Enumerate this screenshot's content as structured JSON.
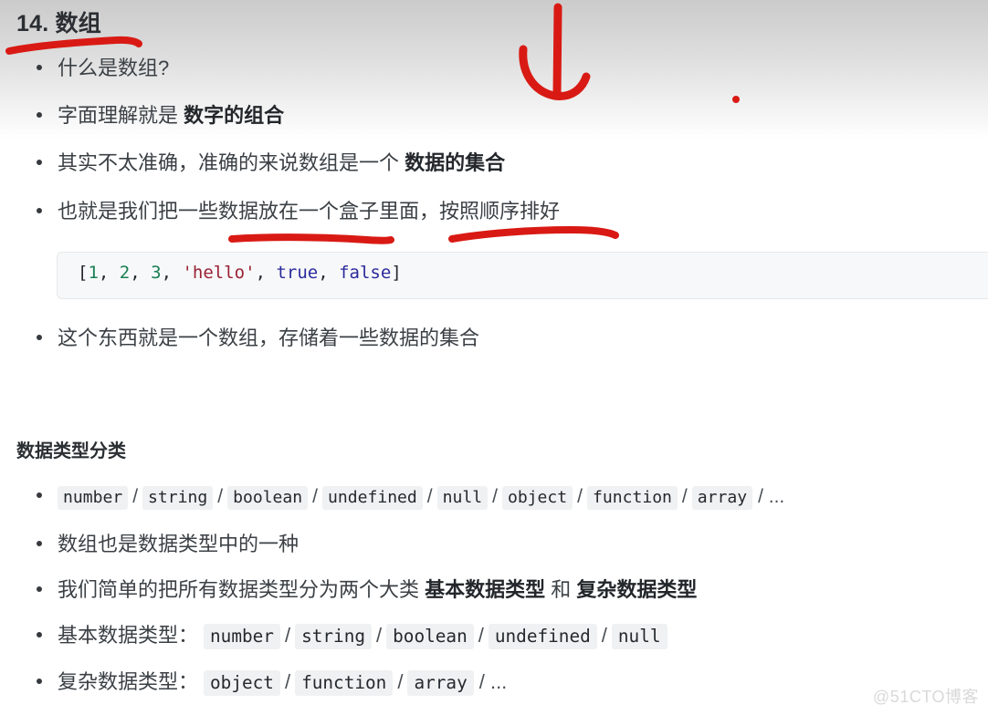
{
  "document": {
    "heading": "14. 数组",
    "section_heading": "数据类型分类",
    "watermark": "@51CTO博客"
  },
  "array_intro_bullets": [
    {
      "text_plain": "什么是数组?",
      "text_bold": ""
    },
    {
      "text_plain": "字面理解就是 ",
      "text_bold": "数字的组合"
    },
    {
      "text_plain": "其实不太准确，准确的来说数组是一个 ",
      "text_bold": "数据的集合"
    },
    {
      "text_plain": "也就是我们把一些数据放在一个盒子里面，按照顺序排好",
      "text_bold": ""
    }
  ],
  "bullet_after_code": "这个东西就是一个数组，存储着一些数据的集合",
  "code_block": {
    "language": "javascript",
    "raw": "[1, 2, 3, 'hello', true, false]",
    "tokens": [
      {
        "t": "[",
        "k": "punc"
      },
      {
        "t": "1",
        "k": "num"
      },
      {
        "t": ", ",
        "k": "punc"
      },
      {
        "t": "2",
        "k": "num"
      },
      {
        "t": ", ",
        "k": "punc"
      },
      {
        "t": "3",
        "k": "num"
      },
      {
        "t": ", ",
        "k": "punc"
      },
      {
        "t": "'hello'",
        "k": "str"
      },
      {
        "t": ", ",
        "k": "punc"
      },
      {
        "t": "true",
        "k": "bool"
      },
      {
        "t": ", ",
        "k": "punc"
      },
      {
        "t": "false",
        "k": "bool"
      },
      {
        "t": "]",
        "k": "punc"
      }
    ]
  },
  "type_rows": {
    "all_types": {
      "chips": [
        "number",
        "string",
        "boolean",
        "undefined",
        "null",
        "object",
        "function",
        "array"
      ],
      "separator": "/",
      "trailing": "/ ..."
    },
    "array_is_type": "数组也是数据类型中的一种",
    "two_categories": {
      "prefix": "我们简单的把所有数据类型分为两个大类 ",
      "bold_1": "基本数据类型",
      "middle": " 和 ",
      "bold_2": "复杂数据类型"
    },
    "primitive": {
      "label": "基本数据类型：",
      "chips": [
        "number",
        "string",
        "boolean",
        "undefined",
        "null"
      ],
      "separator": "/",
      "trailing": ""
    },
    "complex": {
      "label": "复杂数据类型：",
      "chips": [
        "object",
        "function",
        "array"
      ],
      "separator": "/",
      "trailing": "/ ..."
    }
  },
  "annotations": {
    "color": "#d91a14",
    "marks": [
      {
        "name": "underline-heading",
        "kind": "underline"
      },
      {
        "name": "down-arrow",
        "kind": "arrow"
      },
      {
        "name": "red-dot",
        "kind": "dot"
      },
      {
        "name": "underline-box-phrase",
        "kind": "underline"
      },
      {
        "name": "underline-order-phrase",
        "kind": "underline"
      }
    ]
  },
  "colors": {
    "annotation_red": "#d91a14",
    "code_bg": "#f7f8f9",
    "chip_bg": "#f0f1f2",
    "text": "#3b4045",
    "heading": "#2b2f33",
    "num_token": "#1a7f54",
    "str_token": "#9b2235",
    "bool_token": "#2b2b9c"
  }
}
